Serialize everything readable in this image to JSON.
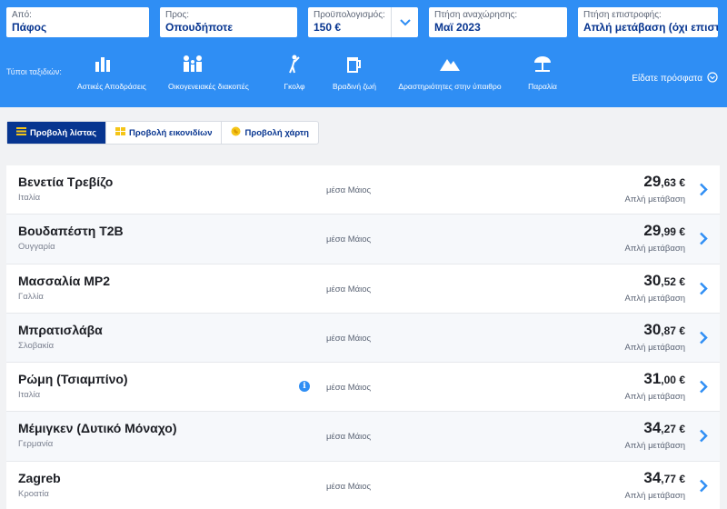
{
  "search": {
    "from": {
      "label": "Από:",
      "value": "Πάφος"
    },
    "to": {
      "label": "Προς:",
      "value": "Οπουδήποτε"
    },
    "budget": {
      "label": "Προϋπολογισμός:",
      "value": "150 €"
    },
    "departure": {
      "label": "Πτήση αναχώρησης:",
      "value": "Μαϊ 2023"
    },
    "return": {
      "label": "Πτήση επιστροφής:",
      "value": "Απλή μετάβαση (όχι επιστρο"
    }
  },
  "trip_types": {
    "label": "Τύποι ταξιδιών:",
    "items": [
      {
        "label": "Αστικές Αποδράσεις",
        "icon": "city-icon"
      },
      {
        "label": "Οικογενειακές διακοπές",
        "icon": "family-icon"
      },
      {
        "label": "Γκολφ",
        "icon": "golf-icon"
      },
      {
        "label": "Βραδινή ζωή",
        "icon": "beer-icon"
      },
      {
        "label": "Δραστηριότητες στην ύπαιθρο",
        "icon": "mountain-icon"
      },
      {
        "label": "Παραλία",
        "icon": "beach-umbrella-icon"
      }
    ],
    "recent": "Είδατε πρόσφατα"
  },
  "view_tabs": [
    {
      "label": "Προβολή λίστας",
      "icon": "list-icon",
      "active": true
    },
    {
      "label": "Προβολή εικονιδίων",
      "icon": "grid-icon",
      "active": false
    },
    {
      "label": "Προβολή χάρτη",
      "icon": "map-icon",
      "active": false
    }
  ],
  "results": [
    {
      "city": "Βενετία Τρεβίζο",
      "country": "Ιταλία",
      "when": "μέσα Μάιος",
      "price_int": "29",
      "price_dec": ",63 €",
      "trip": "Απλή μετάβαση",
      "info": false
    },
    {
      "city": "Βουδαπέστη T2B",
      "country": "Ουγγαρία",
      "when": "μέσα Μάιος",
      "price_int": "29",
      "price_dec": ",99 €",
      "trip": "Απλή μετάβαση",
      "info": false
    },
    {
      "city": "Μασσαλία MP2",
      "country": "Γαλλία",
      "when": "μέσα Μάιος",
      "price_int": "30",
      "price_dec": ",52 €",
      "trip": "Απλή μετάβαση",
      "info": false
    },
    {
      "city": "Μπρατισλάβα",
      "country": "Σλοβακία",
      "when": "μέσα Μάιος",
      "price_int": "30",
      "price_dec": ",87 €",
      "trip": "Απλή μετάβαση",
      "info": false
    },
    {
      "city": "Ρώμη (Τσιαμπίνο)",
      "country": "Ιταλία",
      "when": "μέσα Μάιος",
      "price_int": "31",
      "price_dec": ",00 €",
      "trip": "Απλή μετάβαση",
      "info": true
    },
    {
      "city": "Μέμιγκεν (Δυτικό Μόναχο)",
      "country": "Γερμανία",
      "when": "μέσα Μάιος",
      "price_int": "34",
      "price_dec": ",27 €",
      "trip": "Απλή μετάβαση",
      "info": false
    },
    {
      "city": "Zagreb",
      "country": "Κροατία",
      "when": "μέσα Μάιος",
      "price_int": "34",
      "price_dec": ",77 €",
      "trip": "Απλή μετάβαση",
      "info": false
    }
  ],
  "colors": {
    "brand_blue": "#2f8ef4",
    "navy": "#073590",
    "bg": "#f1f2f4"
  }
}
